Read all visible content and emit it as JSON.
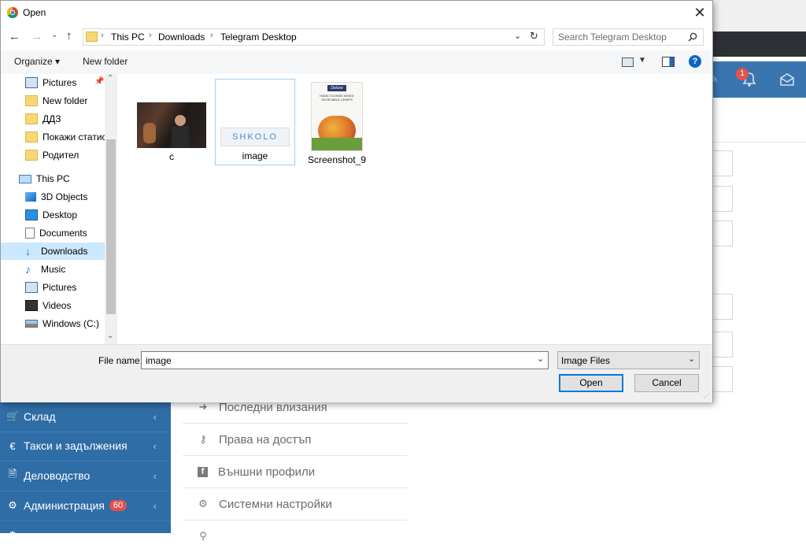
{
  "dialog": {
    "title": "Open",
    "address": {
      "crumbs": [
        "This PC",
        "Downloads",
        "Telegram Desktop"
      ]
    },
    "search_placeholder": "Search Telegram Desktop",
    "toolbar": {
      "organize_label": "Organize ▾",
      "new_folder_label": "New folder"
    },
    "nav": [
      {
        "label": "Pictures",
        "icon": "pictures-icon",
        "pinned": true
      },
      {
        "label": "New folder",
        "icon": "folder-icon"
      },
      {
        "label": "ДДЗ",
        "icon": "folder-icon"
      },
      {
        "label": "Покажи статисти",
        "icon": "folder-icon"
      },
      {
        "label": "Родител",
        "icon": "folder-icon"
      },
      {
        "label": "This PC",
        "icon": "this-pc-icon"
      },
      {
        "label": "3D Objects",
        "icon": "3d-objects-icon"
      },
      {
        "label": "Desktop",
        "icon": "desktop-icon"
      },
      {
        "label": "Documents",
        "icon": "documents-icon"
      },
      {
        "label": "Downloads",
        "icon": "downloads-icon",
        "selected": true
      },
      {
        "label": "Music",
        "icon": "music-icon"
      },
      {
        "label": "Pictures",
        "icon": "pictures-icon"
      },
      {
        "label": "Videos",
        "icon": "videos-icon"
      },
      {
        "label": "Windows (C:)",
        "icon": "drive-icon"
      }
    ],
    "files": [
      {
        "name": "c"
      },
      {
        "name": "image",
        "selected": true,
        "logo_text": "SHKOLO"
      },
      {
        "name": "Screenshot_9",
        "package_brand": "Deluxe",
        "package_text": "HAND COOKED MIXED VEGETABLE CRISPS"
      }
    ],
    "file_name_label": "File name:",
    "file_name_value": "image",
    "file_type_value": "Image Files",
    "open_label": "Open",
    "cancel_label": "Cancel"
  },
  "background": {
    "notification_count": "1",
    "sidebar": [
      {
        "label": "Склад",
        "icon": "cart-icon"
      },
      {
        "label": "Такси и задължения",
        "icon": "euro-icon"
      },
      {
        "label": "Деловодство",
        "icon": "document-icon"
      },
      {
        "label": "Администрация",
        "icon": "gears-icon",
        "badge": "60"
      }
    ],
    "menu": [
      {
        "label": "Последни влизания",
        "icon": "sign-in-icon"
      },
      {
        "label": "Права на достъп",
        "icon": "key-icon"
      },
      {
        "label": "Външни профили",
        "icon": "facebook-icon"
      },
      {
        "label": "Системни настройки",
        "icon": "gears-icon"
      }
    ]
  },
  "colors": {
    "sidebar_bg": "#2f6da6",
    "accent_blue": "#0078d7",
    "selection": "#cce8ff",
    "badge_red": "#e0534c"
  }
}
